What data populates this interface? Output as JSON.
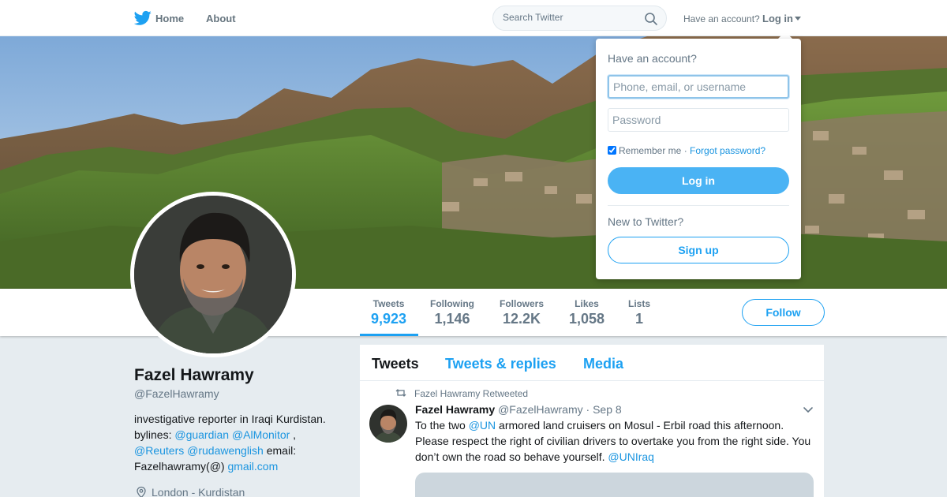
{
  "nav": {
    "home_label": "Home",
    "about_label": "About",
    "search_placeholder": "Search Twitter",
    "account_question": "Have an account?",
    "login_label": "Log in",
    "icons": [
      "twitter-bird-icon",
      "search-icon",
      "caret-down-icon"
    ]
  },
  "profile": {
    "name": "Fazel Hawramy",
    "handle": "@FazelHawramy",
    "bio": {
      "line1": "investigative reporter in Iraqi Kurdistan.",
      "bylines_prefix": "bylines: ",
      "mention_guardian": "@guardian",
      "mention_almonitor": "@AlMonitor",
      "comma": " ,",
      "mention_reuters": "@Reuters",
      "mention_rudaw": "@rudawenglish",
      "email_label": " email:",
      "email_text": "Fazelhawramy(@) ",
      "email_link": "gmail.com"
    },
    "location": "London - Kurdistan"
  },
  "stats": [
    {
      "label": "Tweets",
      "value": "9,923",
      "active": true
    },
    {
      "label": "Following",
      "value": "1,146"
    },
    {
      "label": "Followers",
      "value": "12.2K"
    },
    {
      "label": "Likes",
      "value": "1,058"
    },
    {
      "label": "Lists",
      "value": "1"
    }
  ],
  "follow_label": "Follow",
  "timeline": {
    "tabs": [
      "Tweets",
      "Tweets & replies",
      "Media"
    ],
    "tweet": {
      "retweet_context": "Fazel Hawramy Retweeted",
      "author_name": "Fazel Hawramy",
      "author_handle": "@FazelHawramy",
      "time": "· Sep 8",
      "text_1": "To the two ",
      "mention_un": "@UN",
      "text_2": " armored land cruisers on Mosul - Erbil road this afternoon. Please respect the right of civilian drivers to overtake you from the right side. You don’t own the road so behave yourself. ",
      "mention_uniraq": "@UNIraq"
    }
  },
  "login_dropdown": {
    "title": "Have an account?",
    "username_placeholder": "Phone, email, or username",
    "password_placeholder": "Password",
    "remember_label": "Remember me",
    "separator": " · ",
    "forgot_label": "Forgot password?",
    "login_button": "Log in",
    "new_question": "New to Twitter?",
    "signup_button": "Sign up"
  },
  "colors": {
    "accent": "#1da1f2",
    "link": "#1b95e0",
    "login_button": "#4ab3f4"
  }
}
